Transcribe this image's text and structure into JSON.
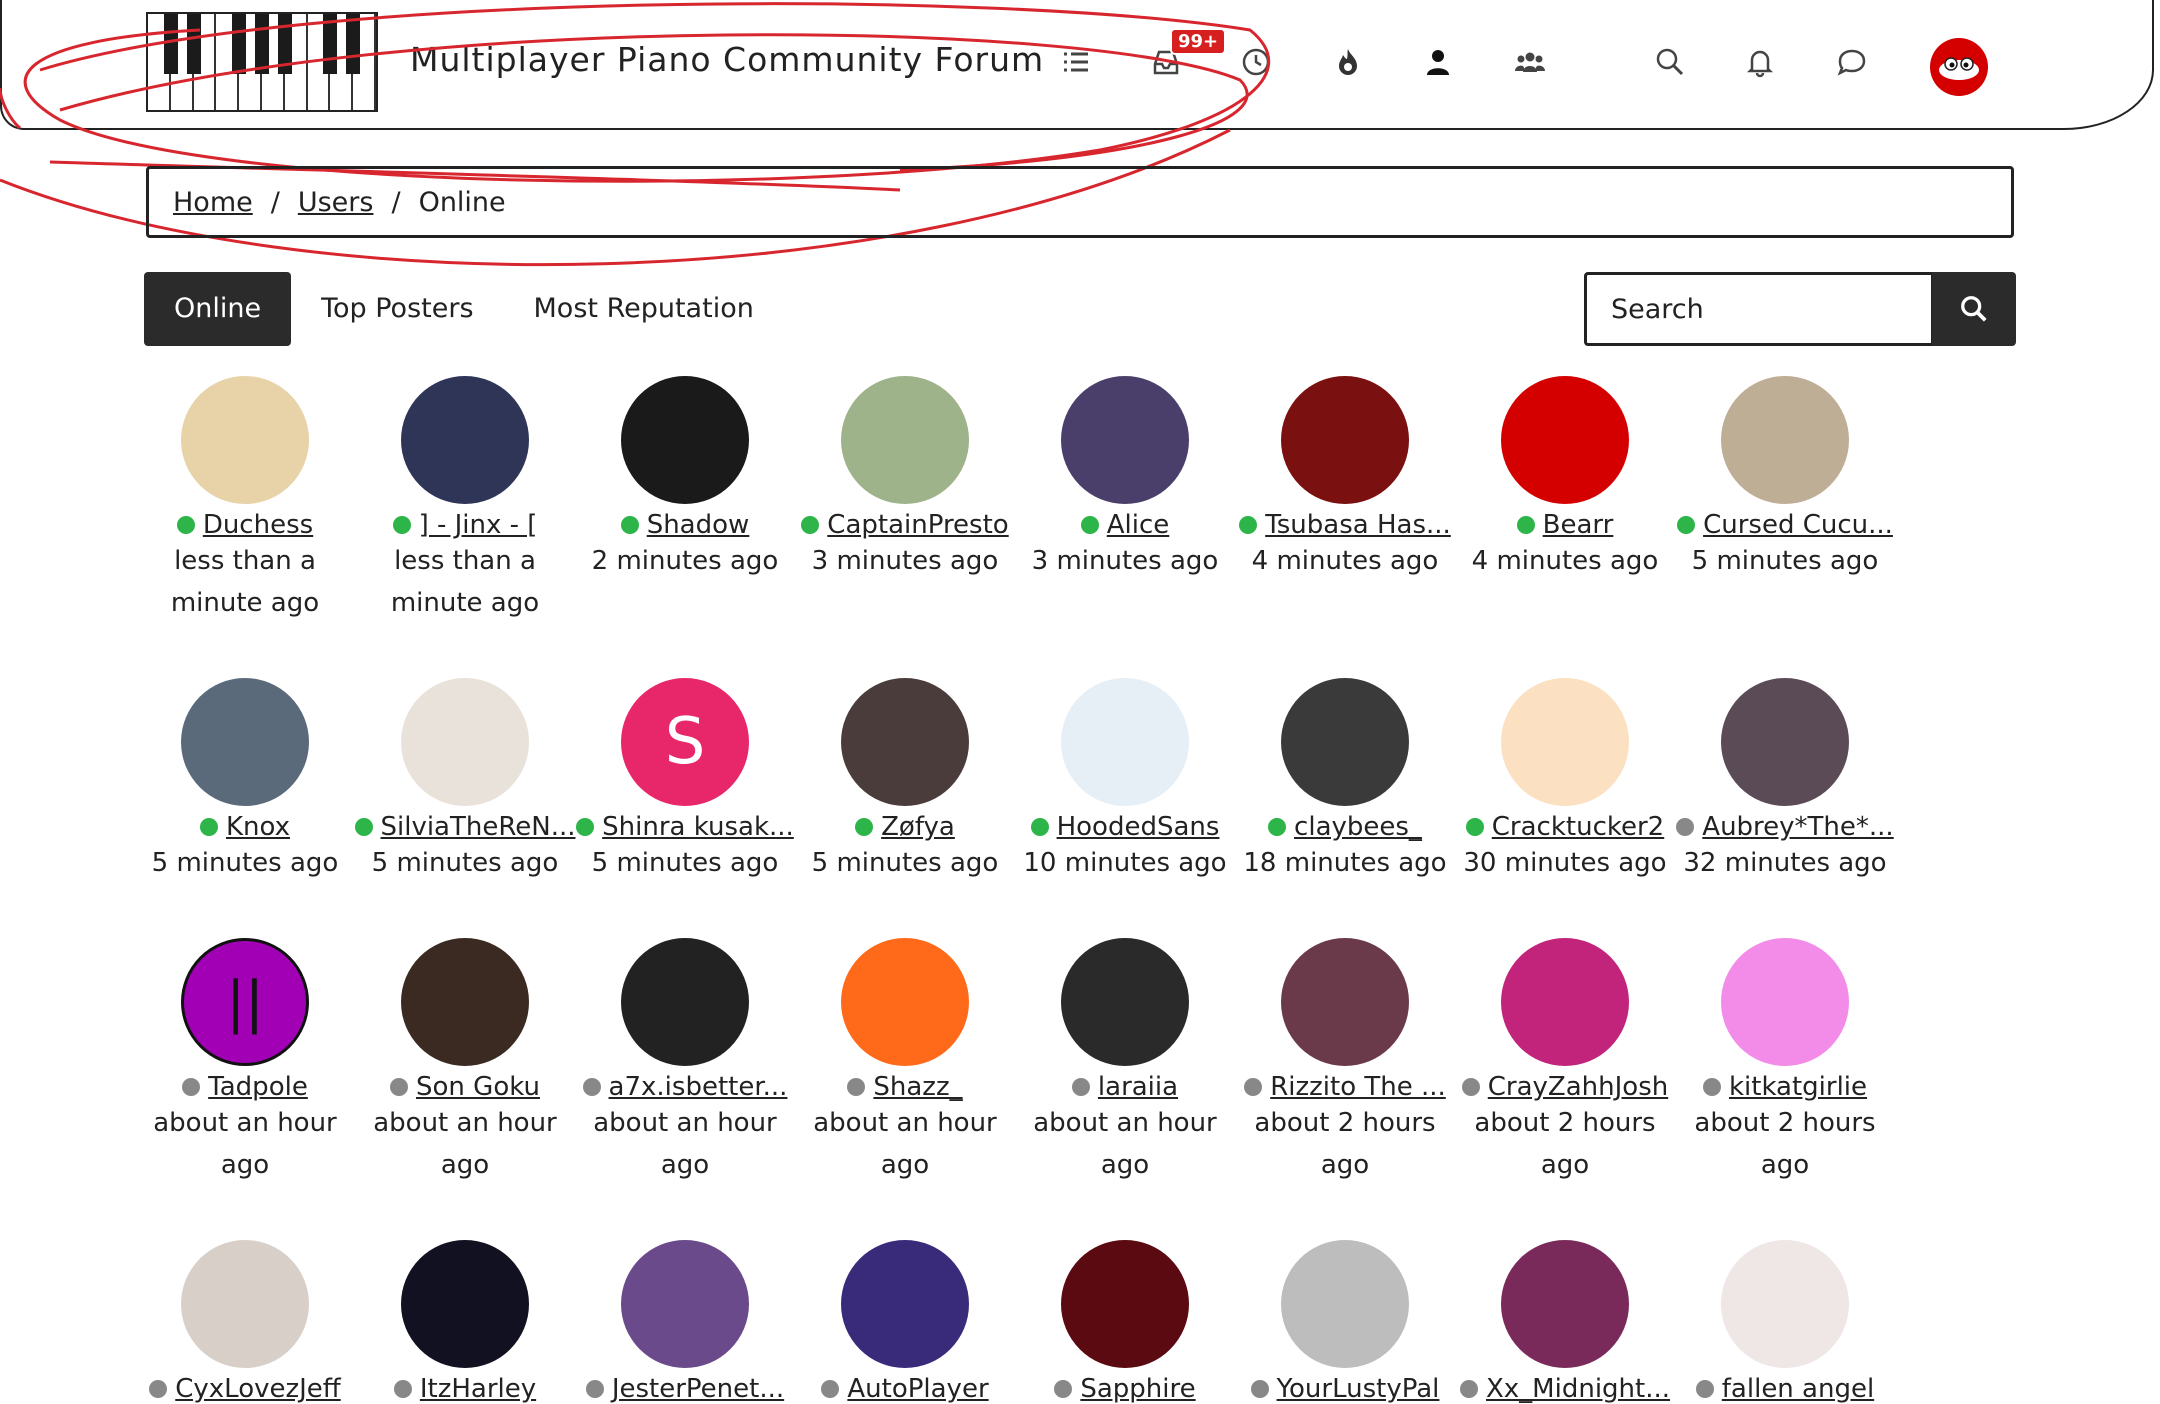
{
  "site": {
    "title": "Multiplayer Piano Community Forum",
    "notification_badge": "99+"
  },
  "nav_icons": [
    "list-icon",
    "inbox-icon",
    "clock-icon",
    "fire-icon",
    "user-icon",
    "users-icon",
    "search-icon",
    "bell-icon",
    "chat-icon"
  ],
  "breadcrumb": {
    "home": "Home",
    "users": "Users",
    "current": "Online"
  },
  "tabs": {
    "online": "Online",
    "top_posters": "Top Posters",
    "most_reputation": "Most Reputation"
  },
  "search": {
    "placeholder": "Search"
  },
  "colors": {
    "online": "#2db54a",
    "away": "#888888",
    "accent_dark": "#2b2b2b",
    "scribble": "#d8262f"
  },
  "users": [
    {
      "name": "Duchess",
      "time": "less than a minute ago",
      "status": "online",
      "color": "#e8d3a8",
      "letter": ""
    },
    {
      "name": "] - Jinx - [",
      "time": "less than a minute ago",
      "status": "online",
      "color": "#2f3557",
      "letter": ""
    },
    {
      "name": "Shadow",
      "time": "2 minutes ago",
      "status": "online",
      "color": "#1a1a1a",
      "letter": ""
    },
    {
      "name": "CaptainPresto",
      "time": "3 minutes ago",
      "status": "online",
      "color": "#9fb38a",
      "letter": ""
    },
    {
      "name": "Alice",
      "time": "3 minutes ago",
      "status": "online",
      "color": "#4a3f6b",
      "letter": ""
    },
    {
      "name": "Tsubasa Has...",
      "time": "4 minutes ago",
      "status": "online",
      "color": "#7a1010",
      "letter": ""
    },
    {
      "name": "Bearr",
      "time": "4 minutes ago",
      "status": "online",
      "color": "#d40000",
      "letter": ""
    },
    {
      "name": "Cursed Cucu...",
      "time": "5 minutes ago",
      "status": "online",
      "color": "#bfae96",
      "letter": ""
    },
    {
      "name": "Knox",
      "time": "5 minutes ago",
      "status": "online",
      "color": "#5a6a7a",
      "letter": ""
    },
    {
      "name": "SilviaTheReN...",
      "time": "5 minutes ago",
      "status": "online",
      "color": "#e9e2da",
      "letter": ""
    },
    {
      "name": "Shinra kusak...",
      "time": "5 minutes ago",
      "status": "online",
      "color": "#e8266a",
      "letter": "S"
    },
    {
      "name": "Zøfya",
      "time": "5 minutes ago",
      "status": "online",
      "color": "#4a3c3a",
      "letter": ""
    },
    {
      "name": "HoodedSans",
      "time": "10 minutes ago",
      "status": "online",
      "color": "#e6eef6",
      "letter": ""
    },
    {
      "name": "claybees_",
      "time": "18 minutes ago",
      "status": "online",
      "color": "#3a3a3a",
      "letter": ""
    },
    {
      "name": "Cracktucker2",
      "time": "30 minutes ago",
      "status": "online",
      "color": "#fbe0c2",
      "letter": ""
    },
    {
      "name": "Aubrey*The*...",
      "time": "32 minutes ago",
      "status": "away",
      "color": "#5a4b57",
      "letter": ""
    },
    {
      "name": "Tadpole",
      "time": "about an hour ago",
      "status": "away",
      "color": "#a100b5",
      "letter": "||"
    },
    {
      "name": "Son Goku",
      "time": "about an hour ago",
      "status": "away",
      "color": "#3a2a22",
      "letter": ""
    },
    {
      "name": "a7x.isbetter...",
      "time": "about an hour ago",
      "status": "away",
      "color": "#222222",
      "letter": ""
    },
    {
      "name": "Shazz_",
      "time": "about an hour ago",
      "status": "away",
      "color": "#ff6a1a",
      "letter": ""
    },
    {
      "name": "laraiia",
      "time": "about an hour ago",
      "status": "away",
      "color": "#2a2a2a",
      "letter": ""
    },
    {
      "name": "Rizzito The ...",
      "time": "about 2 hours ago",
      "status": "away",
      "color": "#6b3a4a",
      "letter": ""
    },
    {
      "name": "CrayZahhJosh",
      "time": "about 2 hours ago",
      "status": "away",
      "color": "#c1247a",
      "letter": ""
    },
    {
      "name": "kitkatgirlie",
      "time": "about 2 hours ago",
      "status": "away",
      "color": "#f38be8",
      "letter": ""
    },
    {
      "name": "CyxLovezJeff",
      "time": "",
      "status": "away",
      "color": "#d8d0c8",
      "letter": ""
    },
    {
      "name": "ItzHarley",
      "time": "",
      "status": "away",
      "color": "#111122",
      "letter": ""
    },
    {
      "name": "JesterPenet...",
      "time": "",
      "status": "away",
      "color": "#6a4a8a",
      "letter": ""
    },
    {
      "name": "AutoPlayer",
      "time": "",
      "status": "away",
      "color": "#3a2a7a",
      "letter": ""
    },
    {
      "name": "Sapphire",
      "time": "",
      "status": "away",
      "color": "#5a0a10",
      "letter": ""
    },
    {
      "name": "YourLustyPal",
      "time": "",
      "status": "away",
      "color": "#bdbdbd",
      "letter": ""
    },
    {
      "name": "Xx_Midnight...",
      "time": "",
      "status": "away",
      "color": "#7a2a5a",
      "letter": ""
    },
    {
      "name": "fallen angel",
      "time": "",
      "status": "away",
      "color": "#efe6e6",
      "letter": ""
    }
  ]
}
